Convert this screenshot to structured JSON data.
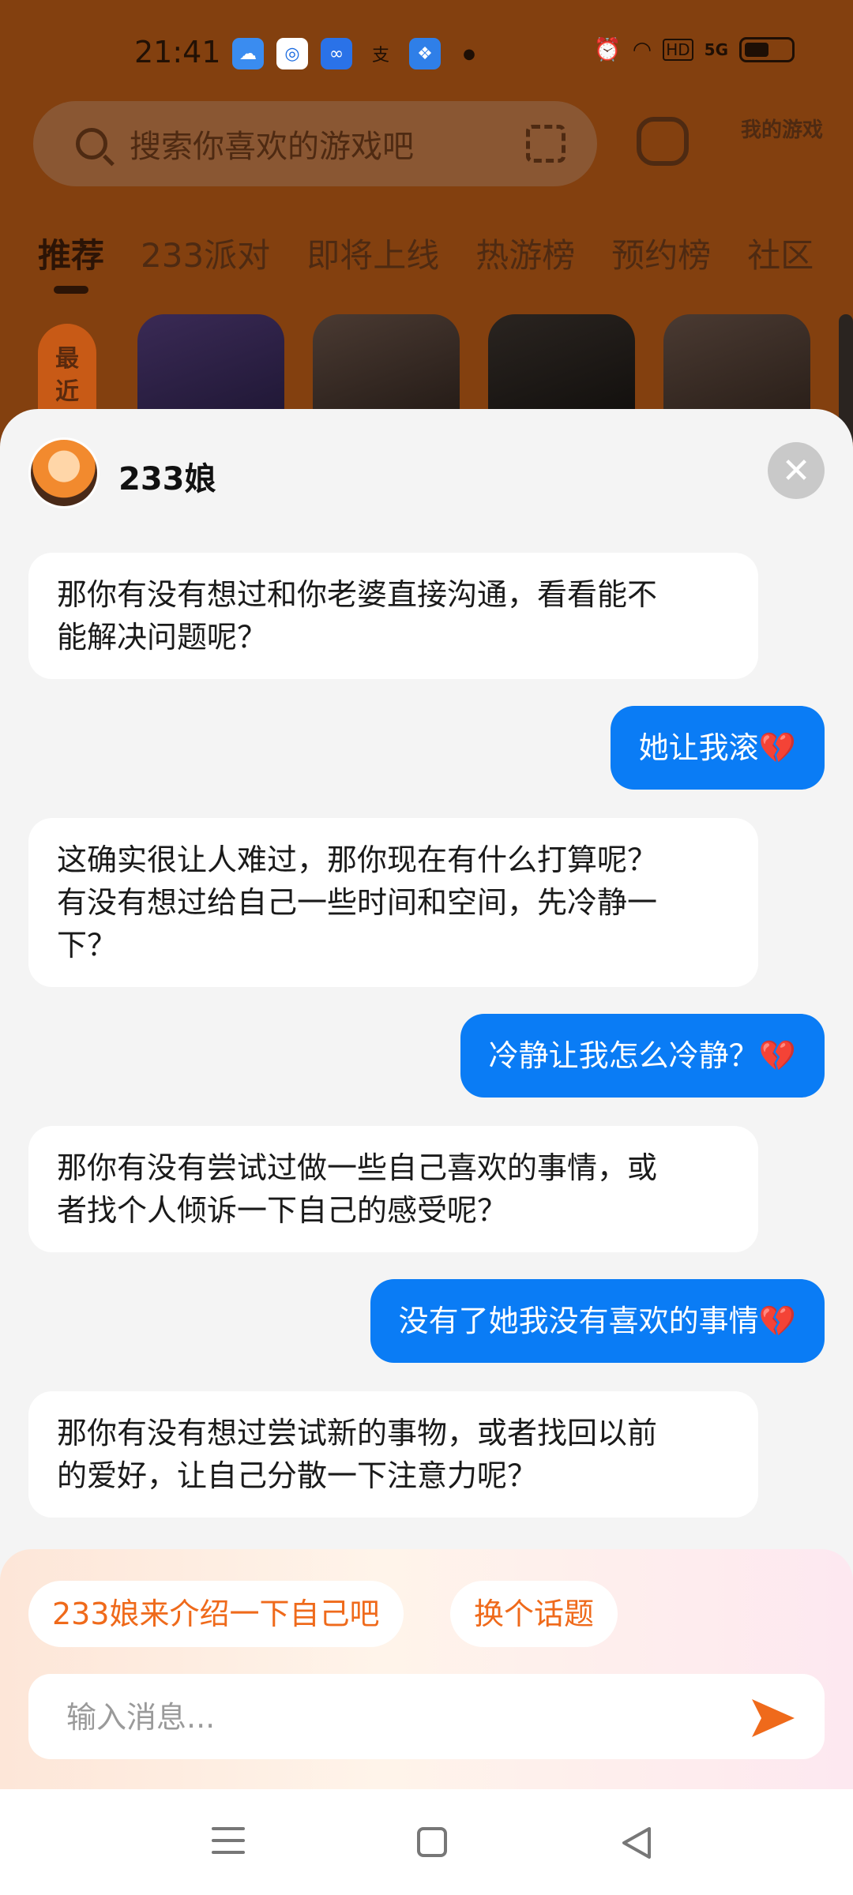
{
  "status_bar": {
    "time": "21:41",
    "network": "5G",
    "hd": "HD"
  },
  "home": {
    "search_placeholder": "搜索你喜欢的游戏吧",
    "my_games_label": "我的游戏",
    "tabs": [
      "推荐",
      "233派对",
      "即将上线",
      "热游榜",
      "预约榜",
      "社区"
    ],
    "active_tab": "推荐",
    "recent_label": "最近在"
  },
  "chat": {
    "bot_name": "233娘",
    "messages": [
      {
        "from": "bot",
        "lines": [
          "那你有没有想过和你老婆直接沟通，看看能不",
          "能解决问题呢？"
        ]
      },
      {
        "from": "user",
        "text": "她让我滚",
        "emoji": "💔"
      },
      {
        "from": "bot",
        "lines": [
          "这确实很让人难过，那你现在有什么打算呢？",
          "有没有想过给自己一些时间和空间，先冷静一",
          "下？"
        ]
      },
      {
        "from": "user",
        "text": "冷静让我怎么冷静？",
        "emoji": "💔"
      },
      {
        "from": "bot",
        "lines": [
          "那你有没有尝试过做一些自己喜欢的事情，或",
          "者找个人倾诉一下自己的感受呢？"
        ]
      },
      {
        "from": "user",
        "text": "没有了她我没有喜欢的事情",
        "emoji": "💔"
      },
      {
        "from": "bot",
        "lines": [
          "那你有没有想过尝试新的事物，或者找回以前",
          "的爱好，让自己分散一下注意力呢？"
        ]
      }
    ],
    "suggestions": [
      "233娘来介绍一下自己吧",
      "换个话题"
    ],
    "input_placeholder": "输入消息..."
  },
  "colors": {
    "accent_orange": "#ef6a1b",
    "user_bubble": "#0a7cf5",
    "sheet_bg": "#f4f4f4"
  }
}
